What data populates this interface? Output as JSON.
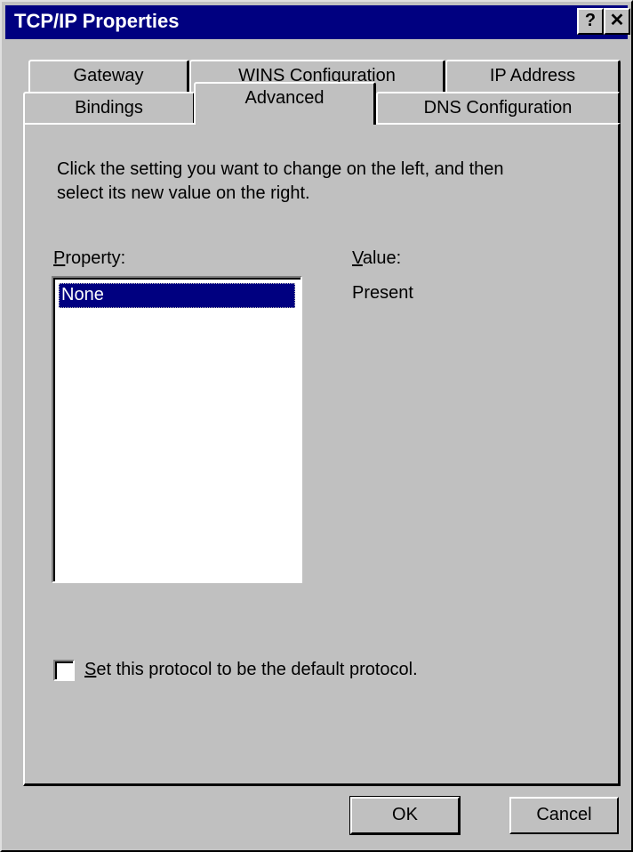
{
  "window": {
    "title": "TCP/IP Properties",
    "help_glyph": "?",
    "close_glyph": "✕"
  },
  "tabs": {
    "row_back": [
      "Gateway",
      "WINS Configuration",
      "IP Address"
    ],
    "row_front": [
      "Bindings",
      "Advanced",
      "DNS Configuration"
    ],
    "active": "Advanced"
  },
  "panel": {
    "instruction_line1": "Click the setting you want to change on the left, and then",
    "instruction_line2": "select its new value on the right.",
    "property_label_accel": "P",
    "property_label_rest": "roperty:",
    "value_label_accel": "V",
    "value_label_rest": "alue:",
    "property_items": [
      "None"
    ],
    "selected_property": "None",
    "value_text": "Present",
    "checkbox_accel": "S",
    "checkbox_label_rest": "et this protocol to be the default protocol.",
    "checkbox_checked": false
  },
  "buttons": {
    "ok": "OK",
    "cancel": "Cancel"
  }
}
